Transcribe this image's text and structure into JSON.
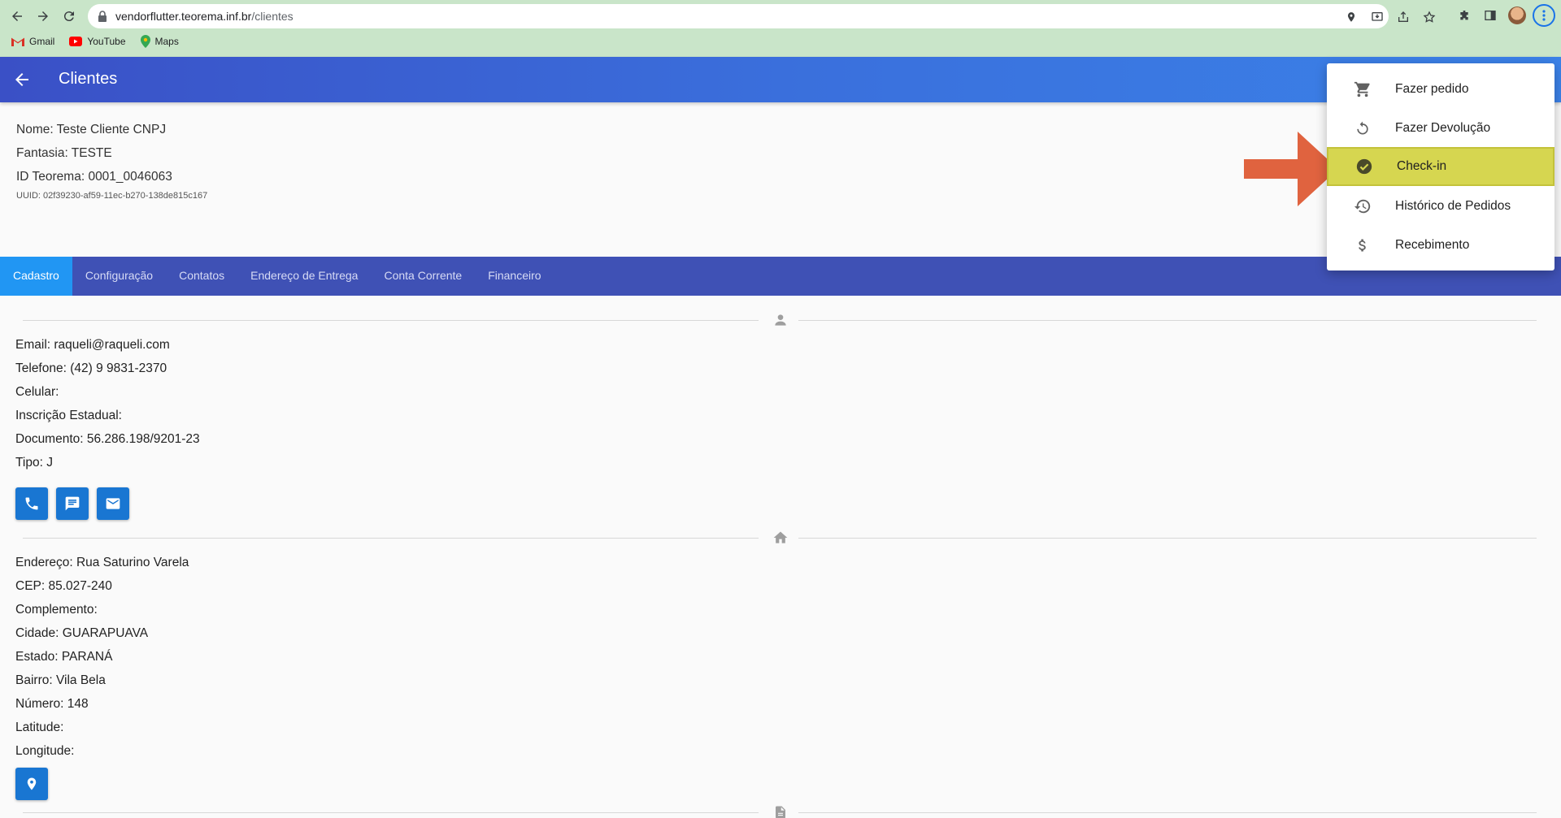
{
  "browser": {
    "url_host": "vendorflutter.teorema.inf.br",
    "url_path": "/clientes",
    "bookmarks": [
      {
        "label": "Gmail",
        "icon": "gmail-icon"
      },
      {
        "label": "YouTube",
        "icon": "youtube-icon"
      },
      {
        "label": "Maps",
        "icon": "maps-icon"
      }
    ]
  },
  "appbar": {
    "title": "Clientes"
  },
  "client": {
    "nome": "Nome: Teste Cliente CNPJ",
    "fantasia": "Fantasia: TESTE",
    "id_teorema": "ID Teorema:  0001_0046063",
    "uuid": "UUID: 02f39230-af59-11ec-b270-138de815c167"
  },
  "tabs": [
    {
      "label": "Cadastro",
      "active": true
    },
    {
      "label": "Configuração",
      "active": false
    },
    {
      "label": "Contatos",
      "active": false
    },
    {
      "label": "Endereço de Entrega",
      "active": false
    },
    {
      "label": "Conta Corrente",
      "active": false
    },
    {
      "label": "Financeiro",
      "active": false
    }
  ],
  "contact": {
    "email": "Email: raqueli@raqueli.com",
    "telefone": "Telefone: (42) 9 9831-2370",
    "celular": "Celular:",
    "inscricao": "Inscrição Estadual:",
    "documento": "Documento: 56.286.198/9201-23",
    "tipo": "Tipo: J"
  },
  "address": {
    "endereco": "Endereço: Rua Saturino Varela",
    "cep": "CEP: 85.027-240",
    "complemento": "Complemento:",
    "cidade": "Cidade: GUARAPUAVA",
    "estado": "Estado: PARANÁ",
    "bairro": "Bairro: Vila Bela",
    "numero": "Número: 148",
    "latitude": "Latitude:",
    "longitude": "Longitude:"
  },
  "menu": {
    "items": [
      {
        "label": "Fazer pedido",
        "icon": "cart-icon"
      },
      {
        "label": "Fazer Devolução",
        "icon": "undo-icon"
      },
      {
        "label": "Check-in",
        "icon": "check-circle-icon",
        "highlighted": true
      },
      {
        "label": "Histórico de Pedidos",
        "icon": "history-icon"
      },
      {
        "label": "Recebimento",
        "icon": "dollar-icon"
      }
    ]
  },
  "colors": {
    "appbar": "#3a6fdc",
    "tabs": "#3f51b5",
    "tab_active": "#2196f3",
    "button": "#1976d2",
    "highlight": "#d6d650",
    "arrow": "#e0633f"
  }
}
